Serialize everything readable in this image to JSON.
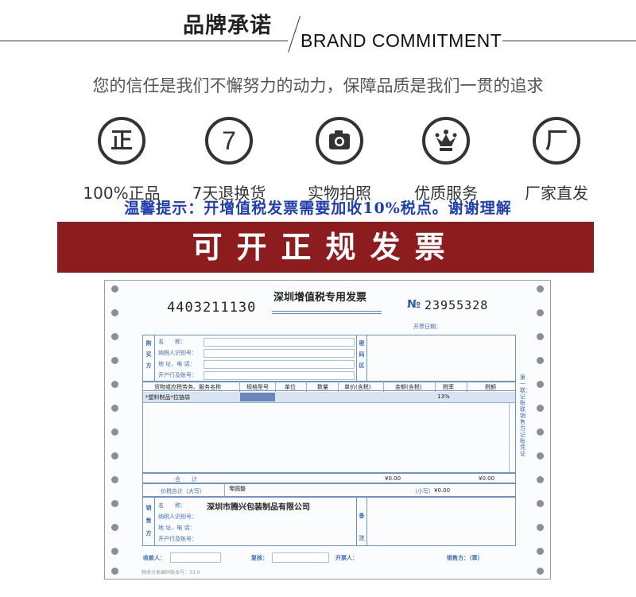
{
  "header": {
    "title_cn": "品牌承诺",
    "title_en": "BRAND COMMITMENT",
    "tagline": "您的信任是我们不懈努力的动力，保障品质是我们一贯的追求"
  },
  "promises": [
    {
      "glyph": "正",
      "icon": "zheng-icon",
      "label": "100%正品"
    },
    {
      "glyph": "7",
      "icon": "seven-day-icon",
      "label": "7天退换货"
    },
    {
      "glyph": "📷",
      "icon": "camera-icon",
      "label": "实物拍照"
    },
    {
      "glyph": "♛",
      "icon": "crown-icon",
      "label": "优质服务"
    },
    {
      "glyph": "厂",
      "icon": "factory-icon",
      "label": "厂家直发"
    }
  ],
  "notice": "温馨提示：开增值税发票需要加收10%税点。谢谢理解",
  "banner": "可开正规发票",
  "invoice": {
    "code": "4403211130",
    "title": "深圳增值税专用发票",
    "no_label": "№",
    "number": "23955328",
    "date_label": "开票日期：",
    "buyer_side": [
      "购",
      "买",
      "方"
    ],
    "buyer_fields": [
      "名　　称：",
      "纳税人识别号：",
      "地 址、电 话：",
      "开户行及账号："
    ],
    "cipher_side": [
      "密",
      "码",
      "区"
    ],
    "columns": [
      "货物或应税劳务、服务名称",
      "规格型号",
      "单位",
      "数量",
      "单价(含税)",
      "金额(含税)",
      "税率",
      "税额"
    ],
    "row": {
      "name": "*塑料制品*拉链袋",
      "tax_rate": "13%"
    },
    "total_label": "合　　计",
    "total_amount": "¥0.00",
    "total_tax": "¥0.00",
    "grand_label": "价税合计（大写）",
    "grand_upper": "零圆整",
    "grand_lower_label": "（小写）",
    "grand_lower": "¥0.00",
    "seller_side": [
      "销",
      "售",
      "方"
    ],
    "seller_fields": [
      "名　　称：",
      "纳税人识别号：",
      "地 址、电 话：",
      "开户行及账号："
    ],
    "seller_name": "深圳市腾兴包装制品有限公司",
    "remark_side": [
      "备",
      "注"
    ],
    "side_note": "第一联：记账联 销售方记账凭证",
    "payee_label": "收款人：",
    "checker_label": "复核：",
    "drawer_label": "开票人：",
    "seal_label": "销售方：（章）",
    "footer_code": "税收分类编码版本号：33.0"
  },
  "colors": {
    "banner": "#8d1c1f",
    "notice": "#1f3fb0",
    "invoice_blue": "#3d6db5"
  }
}
